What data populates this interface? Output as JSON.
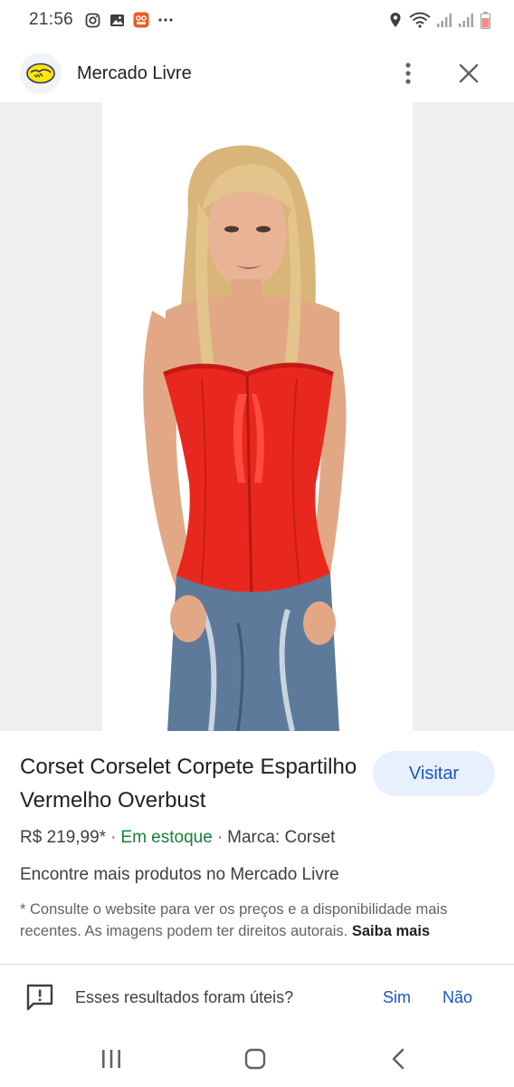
{
  "status_bar": {
    "time": "21:56",
    "left_icons": [
      "instagram-icon",
      "gallery-icon",
      "app-notification-icon",
      "more-notifications-icon"
    ],
    "right_icons": [
      "location-icon",
      "wifi-icon",
      "signal-icon",
      "signal-icon-2",
      "battery-icon"
    ]
  },
  "header": {
    "site_name": "Mercado Livre",
    "logo_icon": "mercado-livre-handshake-logo",
    "menu_icon": "more-vert-icon",
    "close_icon": "close-icon"
  },
  "product": {
    "title": "Corset Corselet Corpete Espartilho Vermelho Overbust",
    "visit_label": "Visitar",
    "price": "R$ 219,99*",
    "separator": "·",
    "stock": "Em estoque",
    "brand": "Marca: Corset",
    "more_products": "Encontre mais produtos no Mercado Livre",
    "disclaimer": "* Consulte o website para ver os preços e a disponibilidade mais recentes. As imagens podem ter direitos autorais.",
    "learn_more": "Saiba mais"
  },
  "feedback": {
    "question": "Esses resultados foram úteis?",
    "yes": "Sim",
    "no": "Não"
  },
  "colors": {
    "accent": "#1a56c4",
    "visit_bg": "#e8f0fe",
    "stock_green": "#188038",
    "corset_red": "#e8281e",
    "brand_yellow": "#ffe600"
  }
}
